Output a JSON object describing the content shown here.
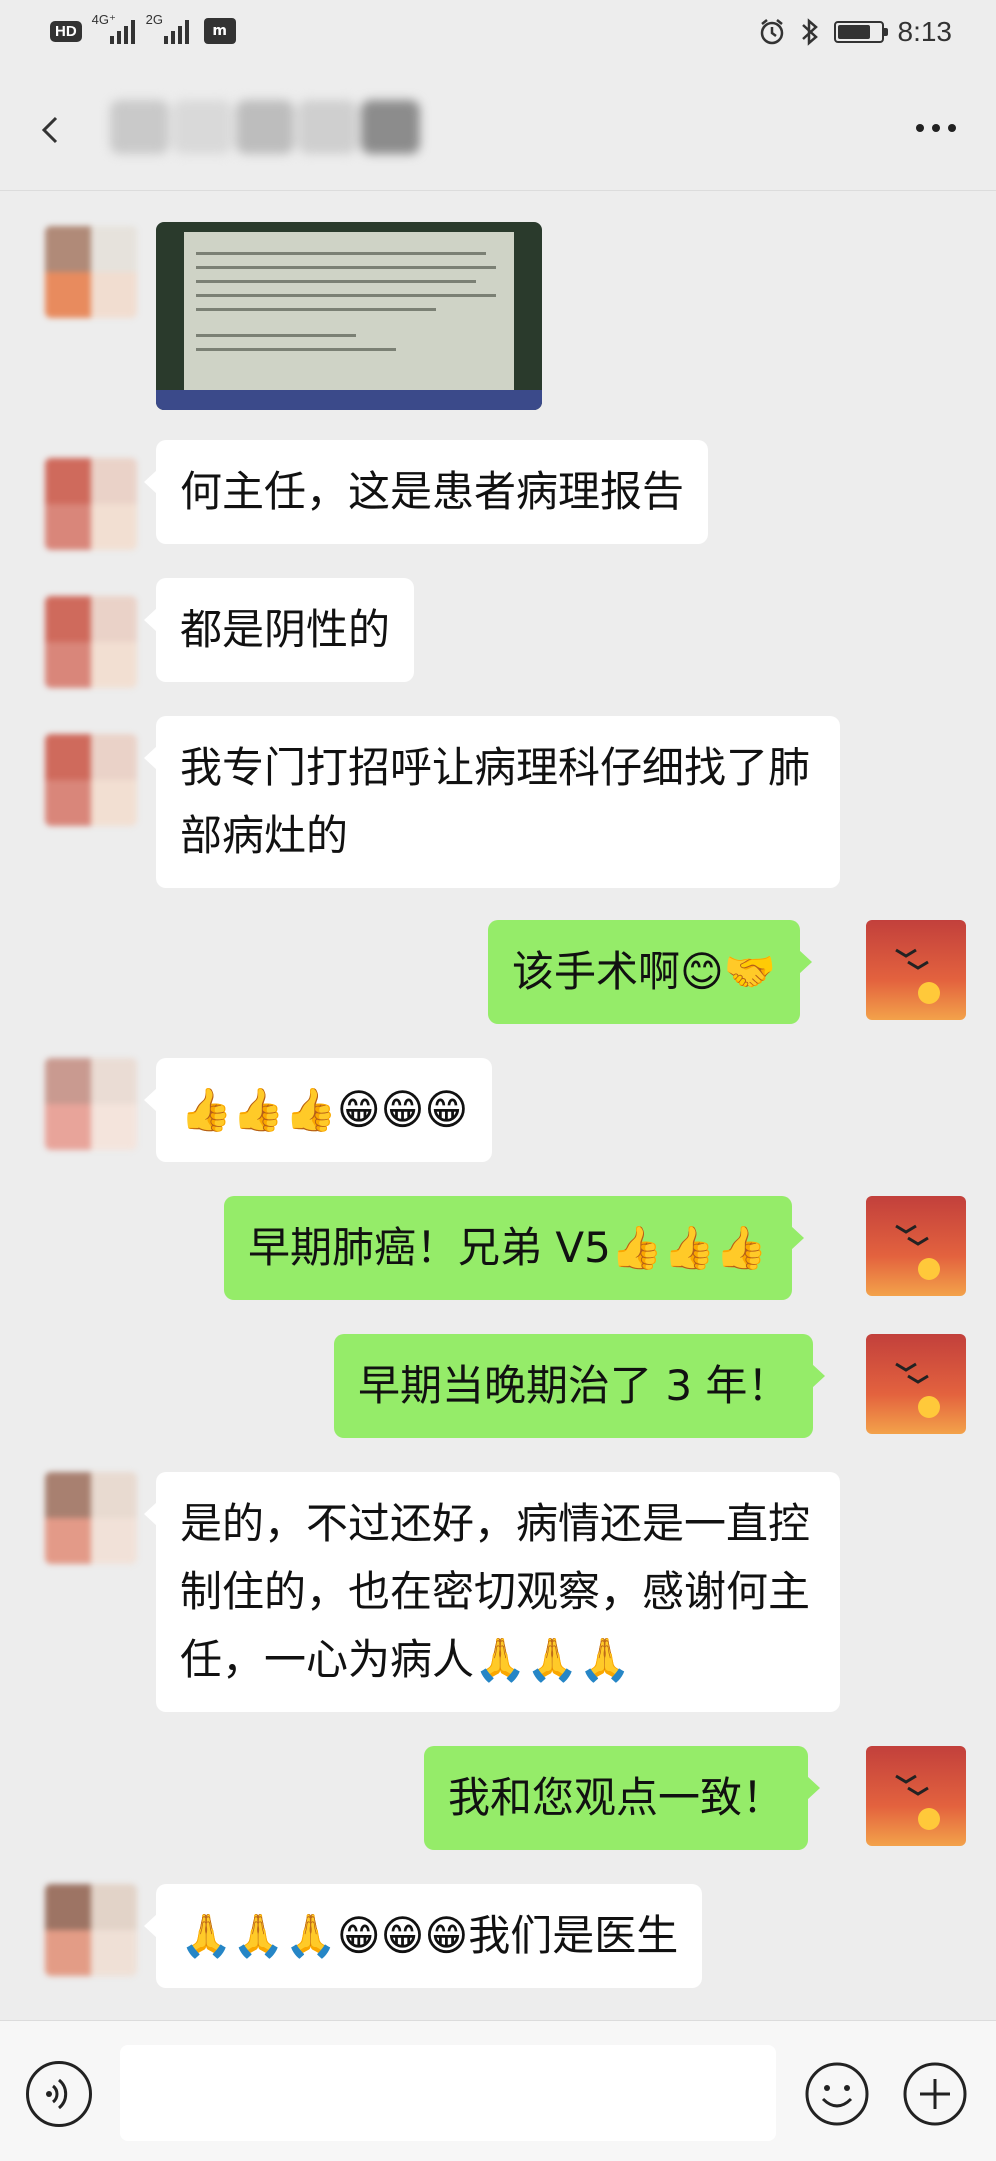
{
  "status_bar": {
    "hd": "HD",
    "signal1_label": "4G⁺",
    "signal2_label": "2G",
    "carrier_icon": "carrier-logo",
    "time": "8:13"
  },
  "header": {
    "back_icon": "chevron-left-icon",
    "more_icon": "more-dots-icon"
  },
  "messages": [
    {
      "side": "left",
      "type": "image",
      "image_desc": "pathology-report-screen"
    },
    {
      "side": "left",
      "text": "何主任，这是患者病理报告"
    },
    {
      "side": "left",
      "text": "都是阴性的"
    },
    {
      "side": "left",
      "text": "我专门打招呼让病理科仔细找了肺部病灶的"
    },
    {
      "side": "right",
      "text": "该手术啊😊🤝"
    },
    {
      "side": "left",
      "text": "👍👍👍😁😁😁"
    },
    {
      "side": "right",
      "text": "早期肺癌！兄弟 V5👍👍👍"
    },
    {
      "side": "right",
      "text": "早期当晚期治了 3 年！"
    },
    {
      "side": "left",
      "text": "是的，不过还好，病情还是一直控制住的，也在密切观察，感谢何主任，一心为病人🙏🙏🙏"
    },
    {
      "side": "right",
      "text": "我和您观点一致！"
    },
    {
      "side": "left",
      "text": "🙏🙏🙏😁😁😁我们是医生"
    }
  ],
  "input_bar": {
    "voice_icon": "voice-icon",
    "input_value": "",
    "emoji_icon": "emoji-icon",
    "plus_icon": "plus-icon"
  },
  "colors": {
    "background": "#ededed",
    "bubble_self": "#95ec69",
    "bubble_other": "#ffffff"
  }
}
